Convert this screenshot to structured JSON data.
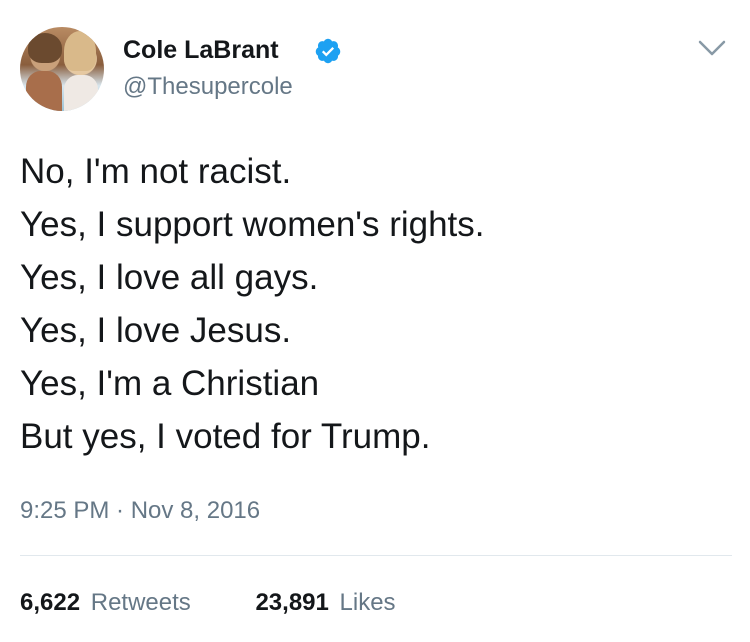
{
  "author": {
    "display_name": "Cole LaBrant",
    "handle": "@Thesupercole",
    "verified": true,
    "verified_color": "#1da1f2"
  },
  "tweet": {
    "lines": [
      "No, I'm not racist.",
      "Yes, I support women's rights.",
      "Yes, I love all gays.",
      "Yes, I love Jesus.",
      "Yes, I'm a Christian",
      "But yes, I voted for Trump."
    ],
    "timestamp": "9:25 PM · Nov 8, 2016"
  },
  "stats": {
    "retweets_count": "6,622",
    "retweets_label": "Retweets",
    "likes_count": "23,891",
    "likes_label": "Likes"
  },
  "icons": {
    "verified": "verified-badge-icon",
    "menu": "chevron-down-icon"
  },
  "colors": {
    "primary_text": "#14171a",
    "secondary_text": "#657786",
    "divider": "#e1e8ed"
  }
}
